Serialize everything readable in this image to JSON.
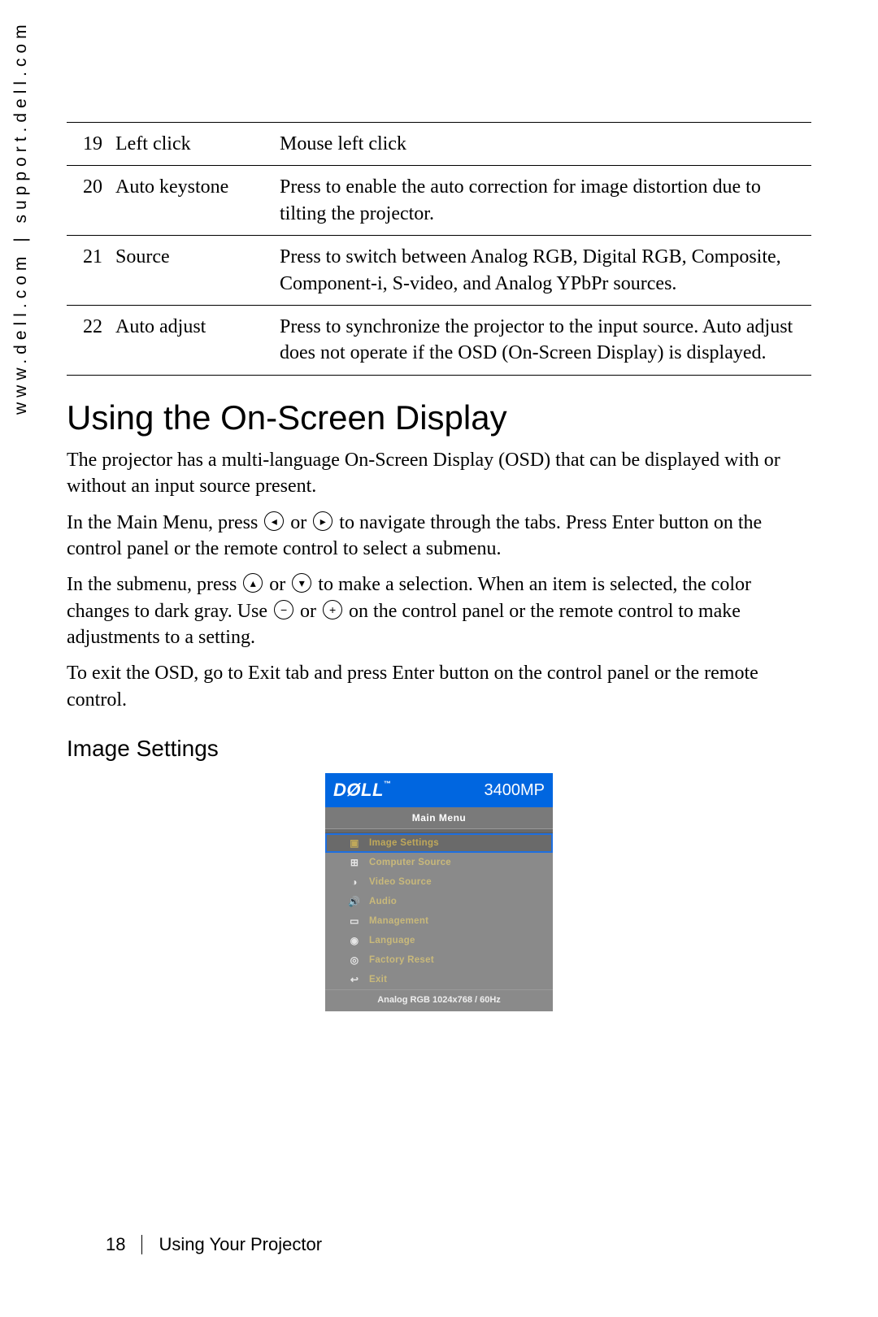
{
  "sidebar": {
    "url": "www.dell.com | support.dell.com"
  },
  "table_rows": [
    {
      "num": "19",
      "name": "Left click",
      "desc": "Mouse left click"
    },
    {
      "num": "20",
      "name": "Auto keystone",
      "desc": "Press to enable the auto correction for image distortion due to tilting the projector."
    },
    {
      "num": "21",
      "name": "Source",
      "desc": "Press to switch between Analog RGB, Digital RGB, Composite, Component-i, S-video, and Analog YPbPr sources."
    },
    {
      "num": "22",
      "name": "Auto adjust",
      "desc": "Press to synchronize the projector to the input source. Auto adjust does not operate if the OSD (On-Screen Display) is displayed."
    }
  ],
  "section_heading": "Using the On-Screen Display",
  "paragraphs": {
    "p1": "The projector has a multi-language On-Screen Display (OSD) that can be displayed with or without an input source present.",
    "p2a": "In the Main Menu, press ",
    "p2b": " or ",
    "p2c": " to navigate through the tabs. Press Enter button on the control panel or the remote control to select a submenu.",
    "p3a": "In the submenu, press ",
    "p3b": " or ",
    "p3c": " to make a selection. When an item is selected, the color changes to dark gray. Use ",
    "p3d": " or ",
    "p3e": " on the control panel or the remote control to make adjustments to a setting.",
    "p4": "To exit the OSD, go to Exit tab and press Enter button on the control panel or the remote control."
  },
  "icons": {
    "left": "◂",
    "right": "▸",
    "up": "▴",
    "down": "▾",
    "minus": "−",
    "plus": "+"
  },
  "subsection": "Image Settings",
  "osd": {
    "brand": "DØLL",
    "tm": "™",
    "model": "3400MP",
    "menu_title": "Main Menu",
    "items": [
      {
        "label": "Image Settings",
        "selected": true
      },
      {
        "label": "Computer Source",
        "selected": false
      },
      {
        "label": "Video Source",
        "selected": false
      },
      {
        "label": "Audio",
        "selected": false
      },
      {
        "label": "Management",
        "selected": false
      },
      {
        "label": "Language",
        "selected": false
      },
      {
        "label": "Factory Reset",
        "selected": false
      },
      {
        "label": "Exit",
        "selected": false
      }
    ],
    "status": "Analog RGB 1024x768 / 60Hz"
  },
  "footer": {
    "page_num": "18",
    "chapter": "Using Your Projector"
  }
}
